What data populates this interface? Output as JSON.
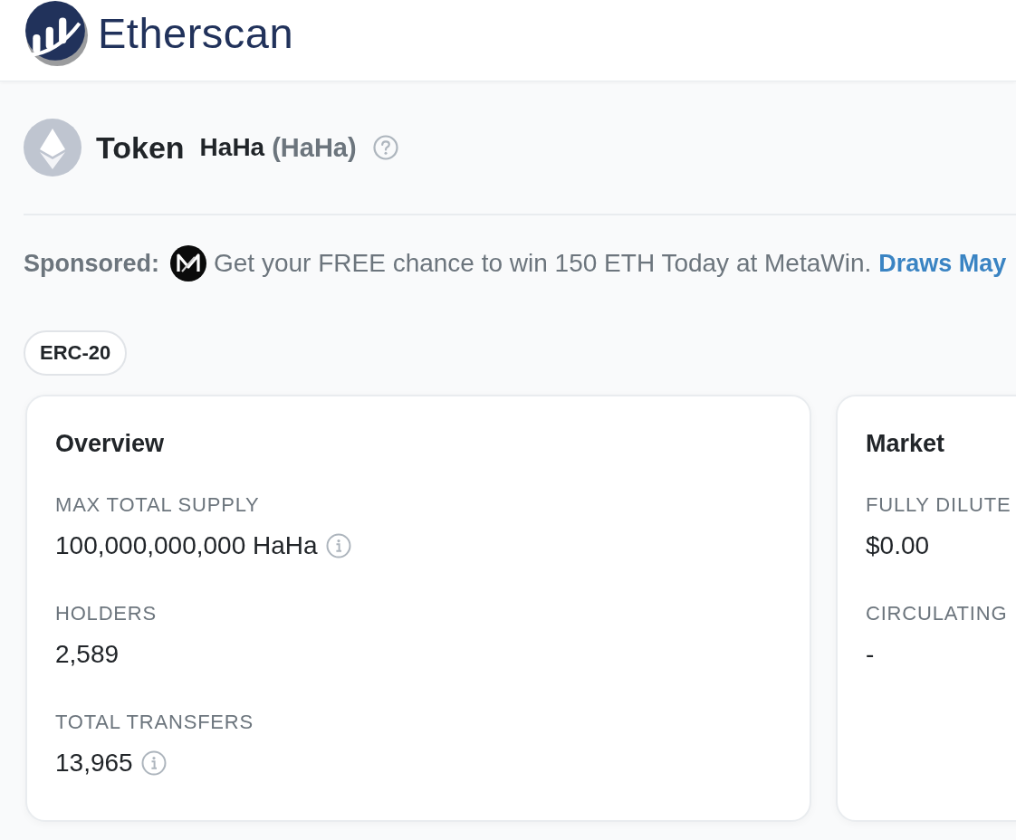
{
  "header": {
    "logo_text": "Etherscan"
  },
  "token": {
    "heading": "Token",
    "name": "HaHa",
    "symbol": "(HaHa)"
  },
  "sponsored": {
    "label": "Sponsored:",
    "text": "Get your FREE chance to win 150 ETH Today at MetaWin.",
    "link": "Draws May"
  },
  "tags": [
    "ERC-20"
  ],
  "cards": [
    {
      "title": "Overview",
      "fields": [
        {
          "label": "MAX TOTAL SUPPLY",
          "value": "100,000,000,000 HaHa",
          "info": true
        },
        {
          "label": "HOLDERS",
          "value": "2,589",
          "info": false
        },
        {
          "label": "TOTAL TRANSFERS",
          "value": "13,965",
          "info": true
        }
      ]
    },
    {
      "title": "Market",
      "fields": [
        {
          "label": "FULLY DILUTE",
          "value": "$0.00",
          "info": false
        },
        {
          "label": "CIRCULATING",
          "value": "-",
          "info": false
        }
      ]
    }
  ]
}
